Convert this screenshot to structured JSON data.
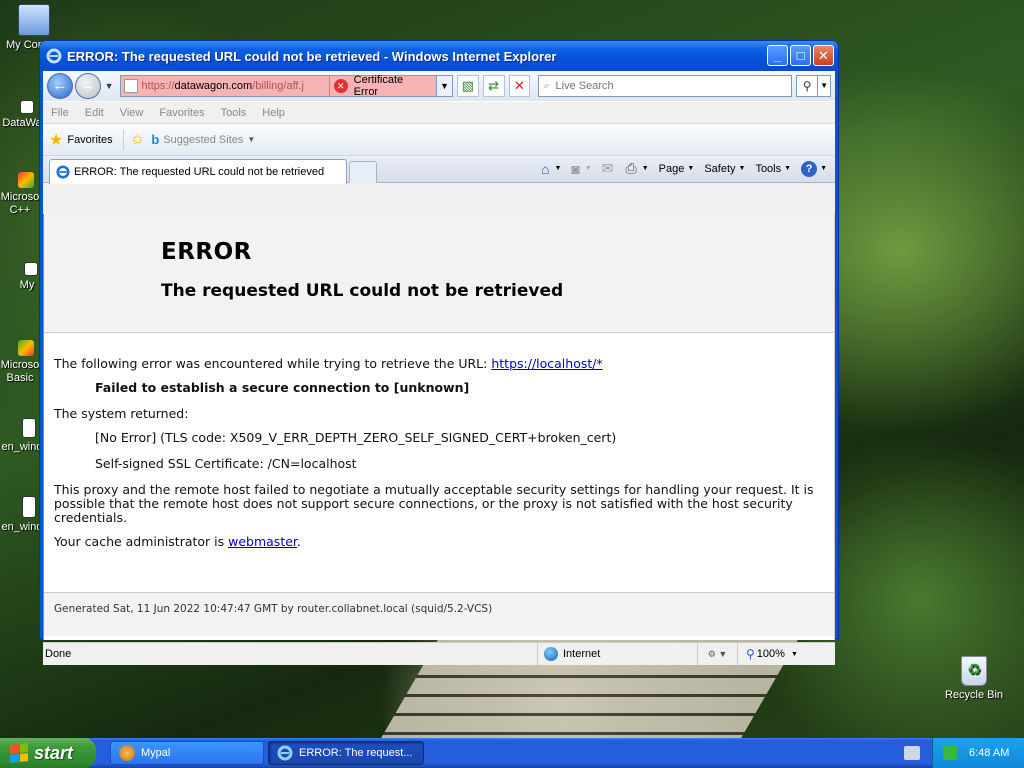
{
  "window": {
    "title": "ERROR: The requested URL could not be retrieved - Windows Internet Explorer",
    "minimize": "_",
    "maximize": "□",
    "close": "✕"
  },
  "navbar": {
    "url_protocol": "https://",
    "url_host": "datawagon.com",
    "url_path": "/billing/aff.j",
    "cert_error_label": "Certificate Error",
    "search_placeholder": "Live Search"
  },
  "menu": [
    "File",
    "Edit",
    "View",
    "Favorites",
    "Tools",
    "Help"
  ],
  "favorites_bar": {
    "favorites_label": "Favorites",
    "suggested_sites_label": "Suggested Sites"
  },
  "tab": {
    "label": "ERROR: The requested URL could not be retrieved"
  },
  "command_bar": {
    "page_label": "Page",
    "safety_label": "Safety",
    "tools_label": "Tools"
  },
  "page": {
    "heading": "ERROR",
    "subheading": "The requested URL could not be retrieved",
    "line1_prefix": "The following error was encountered while trying to retrieve the URL: ",
    "line1_link": "https://localhost/*",
    "failed": "Failed to establish a secure connection to [unknown]",
    "system_returned": "The system returned:",
    "tls_error": "[No Error] (TLS code: X509_V_ERR_DEPTH_ZERO_SELF_SIGNED_CERT+broken_cert)",
    "self_signed": "Self-signed SSL Certificate: /CN=localhost",
    "explanation": "This proxy and the remote host failed to negotiate a mutually acceptable security settings for handling your request. It is possible that the remote host does not support secure connections, or the proxy is not satisfied with the host security credentials.",
    "admin_prefix": "Your cache administrator is ",
    "admin_link": "webmaster",
    "admin_suffix": ".",
    "footer": "Generated Sat, 11 Jun 2022 10:47:47 GMT by router.collabnet.local (squid/5.2-VCS)"
  },
  "statusbar": {
    "status": "Done",
    "zone": "Internet",
    "zoom": "100%"
  },
  "desktop_icons": [
    {
      "label": "My Com"
    },
    {
      "label": "DataWa"
    },
    {
      "label": "Microso C++"
    },
    {
      "label": "My"
    },
    {
      "label": "Microso Basic"
    },
    {
      "label": "en_wind"
    },
    {
      "label": "en_wind"
    },
    {
      "label": "Recycle Bin"
    }
  ],
  "taskbar": {
    "start_label": "start",
    "task1": "Mypal",
    "task2": "ERROR: The request...",
    "clock": "6:48 AM"
  },
  "colors": {
    "titlebar": "#0a5fe0",
    "cert_error_bg": "#f6b3b3",
    "link": "#0000cc",
    "start_green": "#3c9b39",
    "taskbar_blue": "#245edc"
  }
}
